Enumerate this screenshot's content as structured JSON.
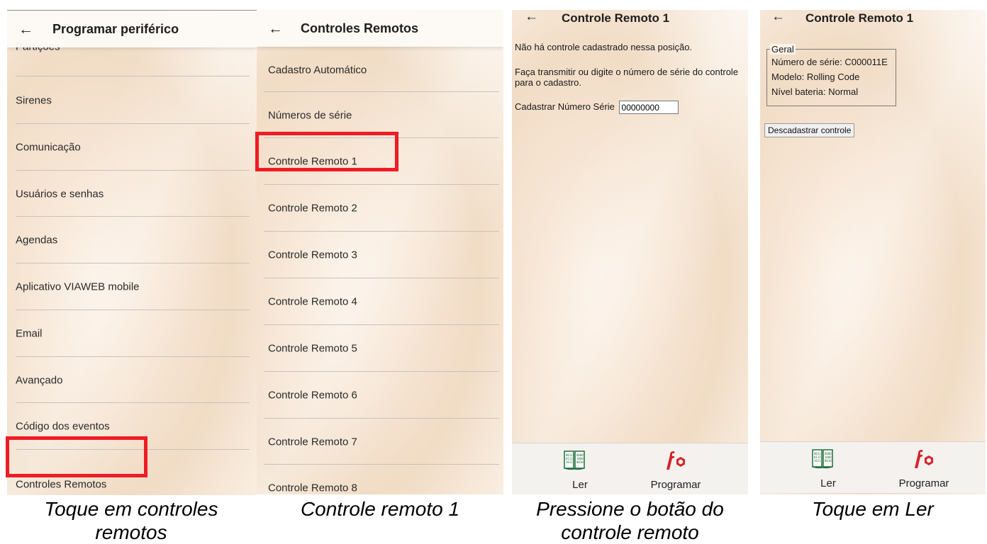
{
  "screens": [
    {
      "title": "Programar periférico",
      "items": [
        "Partições",
        "Sirenes",
        "Comunicação",
        "Usuários e senhas",
        "Agendas",
        "Aplicativo VIAWEB mobile",
        "Email",
        "Avançado",
        "Código dos eventos",
        "Controles Remotos"
      ],
      "caption": "Toque em controles remotos"
    },
    {
      "title": "Controles Remotos",
      "items": [
        "Cadastro Automático",
        "Números de série",
        "Controle Remoto 1",
        "Controle Remoto 2",
        "Controle Remoto 3",
        "Controle Remoto 4",
        "Controle Remoto 5",
        "Controle Remoto 6",
        "Controle Remoto 7",
        "Controle Remoto 8"
      ],
      "caption": "Controle remoto 1"
    },
    {
      "title": "Controle Remoto 1",
      "message1": "Não há controle cadastrado nessa posição.",
      "message2": "Faça transmitir ou digite o número de série do controle para o cadastro.",
      "serial_label": "Cadastrar Número Série",
      "serial_value": "00000000",
      "read_label": "Ler",
      "program_label": "Programar",
      "caption": "Pressione o botão do controle remoto"
    },
    {
      "title": "Controle Remoto 1",
      "group_legend": "Geral",
      "serial": "Número de série: C000011E",
      "model": "Modelo: Rolling Code",
      "battery": "Nível bateria: Normal",
      "unregister_label": "Descadastrar controle",
      "read_label": "Ler",
      "program_label": "Programar",
      "caption": "Toque em Ler"
    }
  ],
  "icons": {
    "back": "arrow-left-icon",
    "read": "binary-book-icon",
    "program": "wrench-nut-icon"
  },
  "colors": {
    "highlight": "#ee1c25",
    "program_icon": "#d4242a",
    "read_icon": "#1f6e3a"
  }
}
